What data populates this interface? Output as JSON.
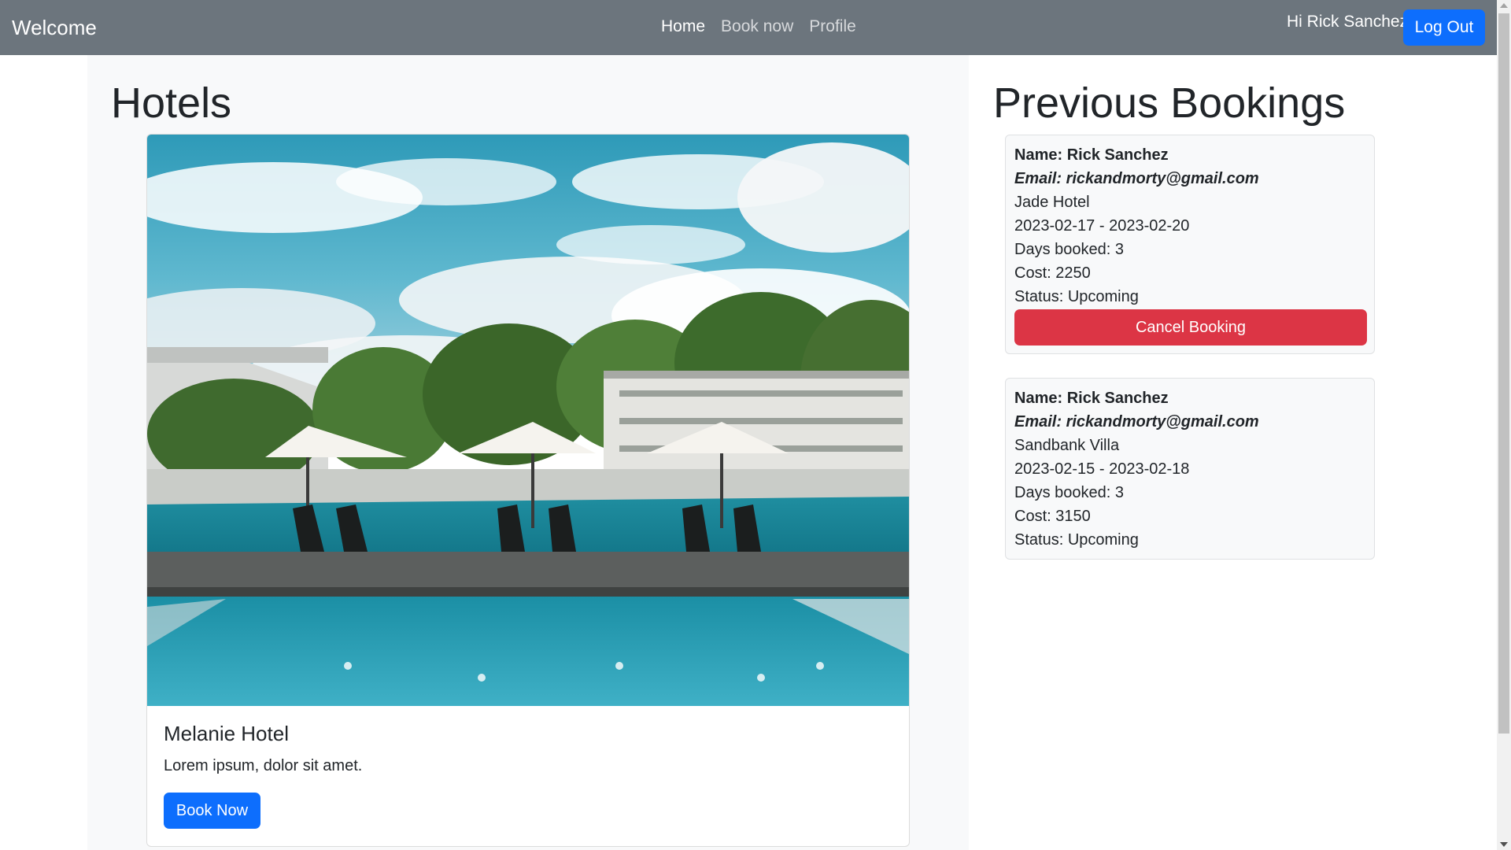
{
  "navbar": {
    "brand": "Welcome",
    "links": [
      "Home",
      "Book now",
      "Profile"
    ],
    "greeting": "Hi Rick Sanchez",
    "logout_label": "Log Out"
  },
  "hotels": {
    "title": "Hotels",
    "card": {
      "image_icon": "hotel-pool-photo",
      "name": "Melanie Hotel",
      "description": "Lorem ipsum, dolor sit amet.",
      "button_label": "Book Now"
    }
  },
  "bookings": {
    "title": "Previous Bookings",
    "items": [
      {
        "name": "Name: Rick Sanchez",
        "email": "Email: rickandmorty@gmail.com",
        "hotel": "Jade Hotel",
        "dates": "2023-02-17 - 2023-02-20",
        "days": "Days booked: 3",
        "cost": "Cost: 2250",
        "status": "Status: Upcoming",
        "cancel_label": "Cancel Booking"
      },
      {
        "name": "Name: Rick Sanchez",
        "email": "Email: rickandmorty@gmail.com",
        "hotel": "Sandbank Villa",
        "dates": "2023-02-15 - 2023-02-18",
        "days": "Days booked: 3",
        "cost": "Cost: 3150",
        "status": "Status: Upcoming"
      }
    ]
  },
  "colors": {
    "navbar": "#6c757d",
    "primary": "#0d6efd",
    "danger": "#dc3545",
    "light": "#f8f9fa"
  }
}
